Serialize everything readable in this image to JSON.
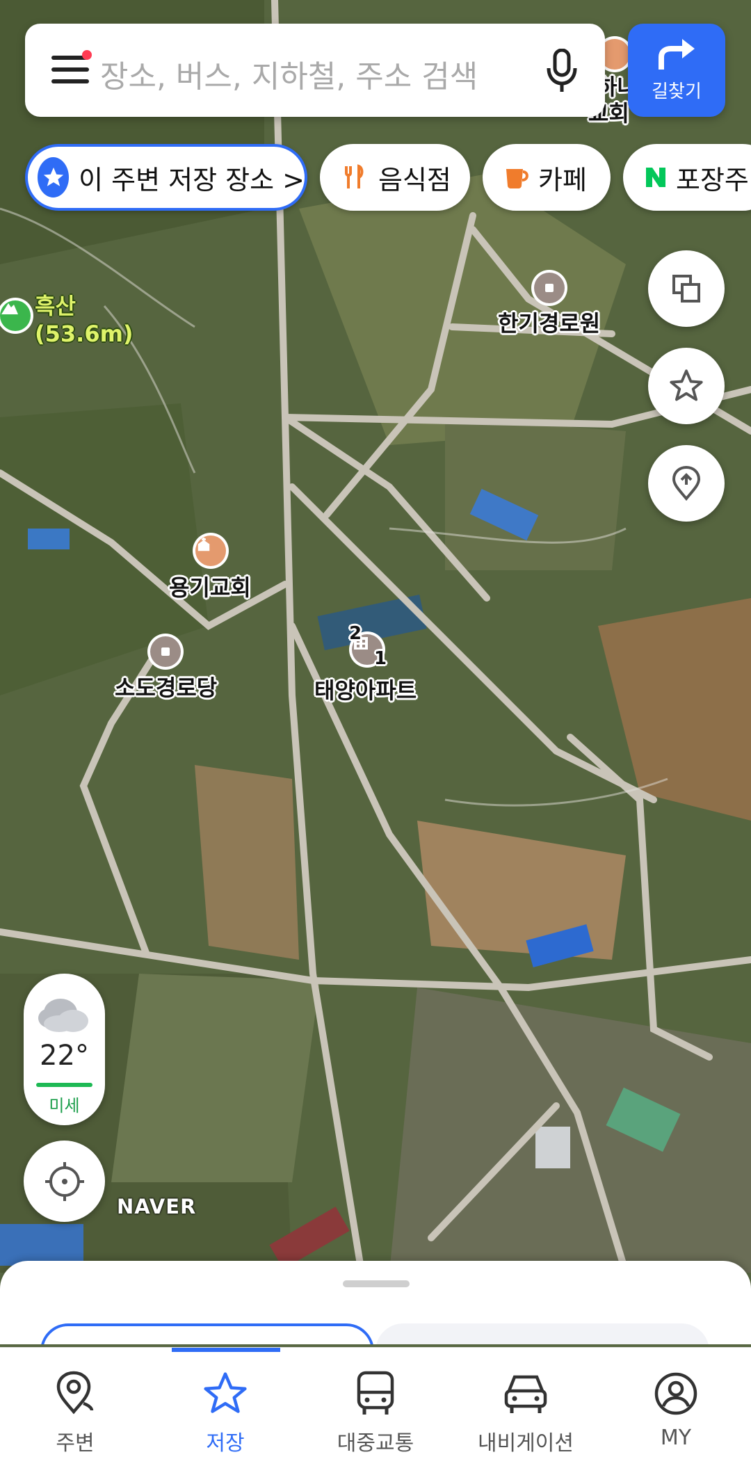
{
  "search": {
    "placeholder": "장소, 버스, 지하철, 주소 검색"
  },
  "directions_label": "길찾기",
  "chips": [
    {
      "label": "이 주변 저장 장소 >",
      "icon": "star-icon"
    },
    {
      "label": "음식점",
      "icon": "fork-knife-icon"
    },
    {
      "label": "카페",
      "icon": "coffee-icon"
    },
    {
      "label": "포장주",
      "icon": "naver-n-icon"
    }
  ],
  "map_labels": {
    "hill_name": "흑산",
    "hill_height": "(53.6m)",
    "senior_center_1": "한기경로원",
    "church": "용기교회",
    "senior_center_2": "소도경로당",
    "apartment": "태양아파트",
    "partial_church": "하나",
    "partial_church2": "교회",
    "building_num_1": "2",
    "building_num_2": "1"
  },
  "weather": {
    "temperature": "22°",
    "dust_label": "미세",
    "icon": "cloud-icon"
  },
  "logo": "NAVER",
  "bottom_nav": [
    {
      "label": "주변",
      "icon": "nearby-pin-icon",
      "active": false
    },
    {
      "label": "저장",
      "icon": "star-icon",
      "active": true
    },
    {
      "label": "대중교통",
      "icon": "bus-icon",
      "active": false
    },
    {
      "label": "내비게이션",
      "icon": "car-icon",
      "active": false
    },
    {
      "label": "MY",
      "icon": "profile-icon",
      "active": false
    }
  ],
  "colors": {
    "accent": "#2f6cf6",
    "dust_good": "#1db954"
  }
}
